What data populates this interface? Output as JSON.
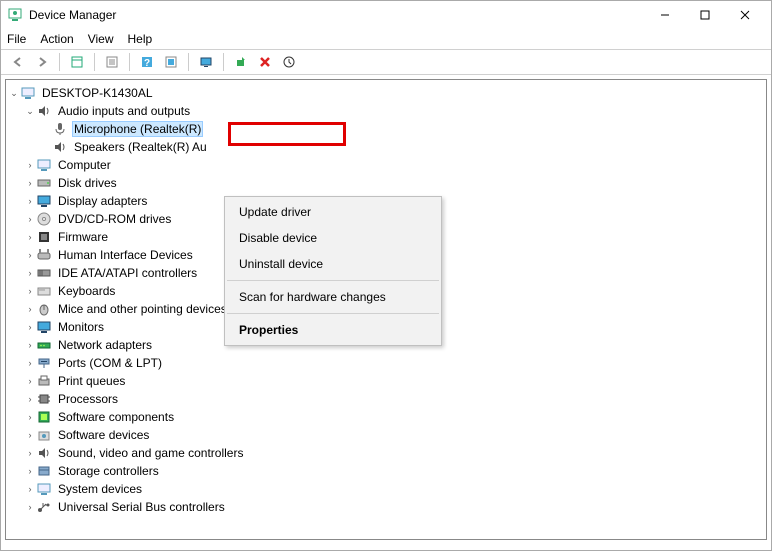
{
  "window": {
    "title": "Device Manager"
  },
  "menubar": {
    "file": "File",
    "action": "Action",
    "view": "View",
    "help": "Help"
  },
  "root": {
    "name": "DESKTOP-K1430AL"
  },
  "audio": {
    "label": "Audio inputs and outputs",
    "mic": "Microphone (Realtek(R)",
    "spk": "Speakers (Realtek(R) Au"
  },
  "nodes": {
    "computer": "Computer",
    "disk": "Disk drives",
    "display": "Display adapters",
    "dvd": "DVD/CD-ROM drives",
    "firmware": "Firmware",
    "hid": "Human Interface Devices",
    "ide": "IDE ATA/ATAPI controllers",
    "keyboards": "Keyboards",
    "mice": "Mice and other pointing devices",
    "monitors": "Monitors",
    "network": "Network adapters",
    "ports": "Ports (COM & LPT)",
    "printq": "Print queues",
    "proc": "Processors",
    "swcomp": "Software components",
    "swdev": "Software devices",
    "sound": "Sound, video and game controllers",
    "storage": "Storage controllers",
    "sysdev": "System devices",
    "usb": "Universal Serial Bus controllers"
  },
  "contextmenu": {
    "update": "Update driver",
    "disable": "Disable device",
    "uninstall": "Uninstall device",
    "scan": "Scan for hardware changes",
    "props": "Properties"
  }
}
